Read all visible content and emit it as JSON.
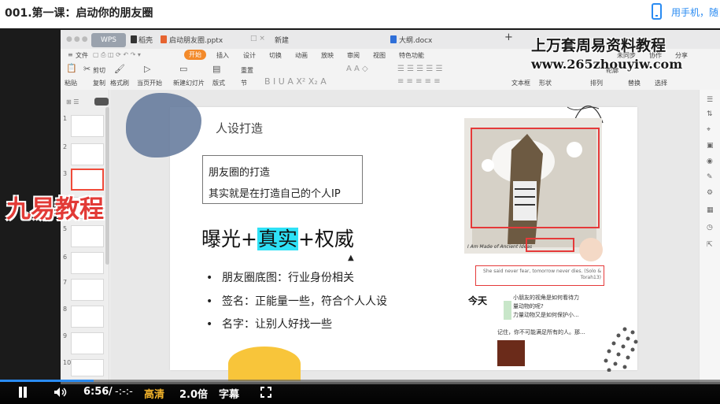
{
  "header": {
    "course_title": "001.第一课：启动你的朋友圈",
    "phone_link": "用手机，随"
  },
  "wps": {
    "tabs": [
      {
        "label": "WPS"
      },
      {
        "label": "稻壳"
      },
      {
        "label": "启动朋友圈.pptx"
      },
      {
        "label": "新建"
      },
      {
        "label": "大纲.docx"
      }
    ],
    "tab_plus": "+",
    "menu": [
      "文件",
      "开始",
      "插入",
      "设计",
      "切换",
      "动画",
      "放映",
      "审阅",
      "视图",
      "特色功能"
    ],
    "active_menu_index": 1,
    "right_menu": [
      "未同步",
      "协作",
      "分享"
    ],
    "ribbon": {
      "paste": "粘贴",
      "cut": "剪切",
      "copy": "复制",
      "format_painter": "格式刷",
      "play_current": "当页开始",
      "new_slide": "新建幻灯片",
      "layout": "版式",
      "section": "节",
      "reset": "重置",
      "text_box": "文本框",
      "shape": "形状",
      "arrange": "排列",
      "outline": "轮廓",
      "replace": "替换",
      "select": "选择"
    },
    "thumbnails": [
      "1",
      "2",
      "3",
      "4",
      "5",
      "6",
      "7",
      "8",
      "9",
      "10"
    ],
    "active_thumbnail": 3
  },
  "watermarks": {
    "top_line1": "上万套周易资料教程",
    "top_line2": "www.265zhouyiw.com",
    "left": "九易教程"
  },
  "slide": {
    "title": "人设打造",
    "box_line1": "朋友圈的打造",
    "box_line2": "其实就是在打造自己的个人IP",
    "heading_part1": "曝光+",
    "heading_highlight": "真实",
    "heading_part2": "+权威",
    "bullets": [
      "朋友圈底图：行业身份相关",
      "签名：正能量一些，符合个人人设",
      "名字：让别人好找一些"
    ],
    "bullet_char": "•",
    "collage_caption": "I Am Made of Ancient Ideas",
    "quote": "She said never fear, tomorrow never dies. (Solo & Torah13)",
    "today_label": "今天",
    "chat_line1": "小朋友的视角是如何看待力",
    "chat_line2": "量动物的呢?",
    "chat_line3": "力量动物又是如何保护小...",
    "chat_line4": "记住，你不可能满足所有的人。那...",
    "accent_highlight": "#2fe1f6",
    "accent_red": "#e53a3a"
  },
  "player": {
    "current_time": "6:56",
    "time_sep": "/",
    "duration": "-:-:-",
    "quality": "高清",
    "speed": "2.0倍",
    "subtitles": "字幕",
    "progress_fraction": 0.13,
    "accent": "#2a8bf2"
  }
}
